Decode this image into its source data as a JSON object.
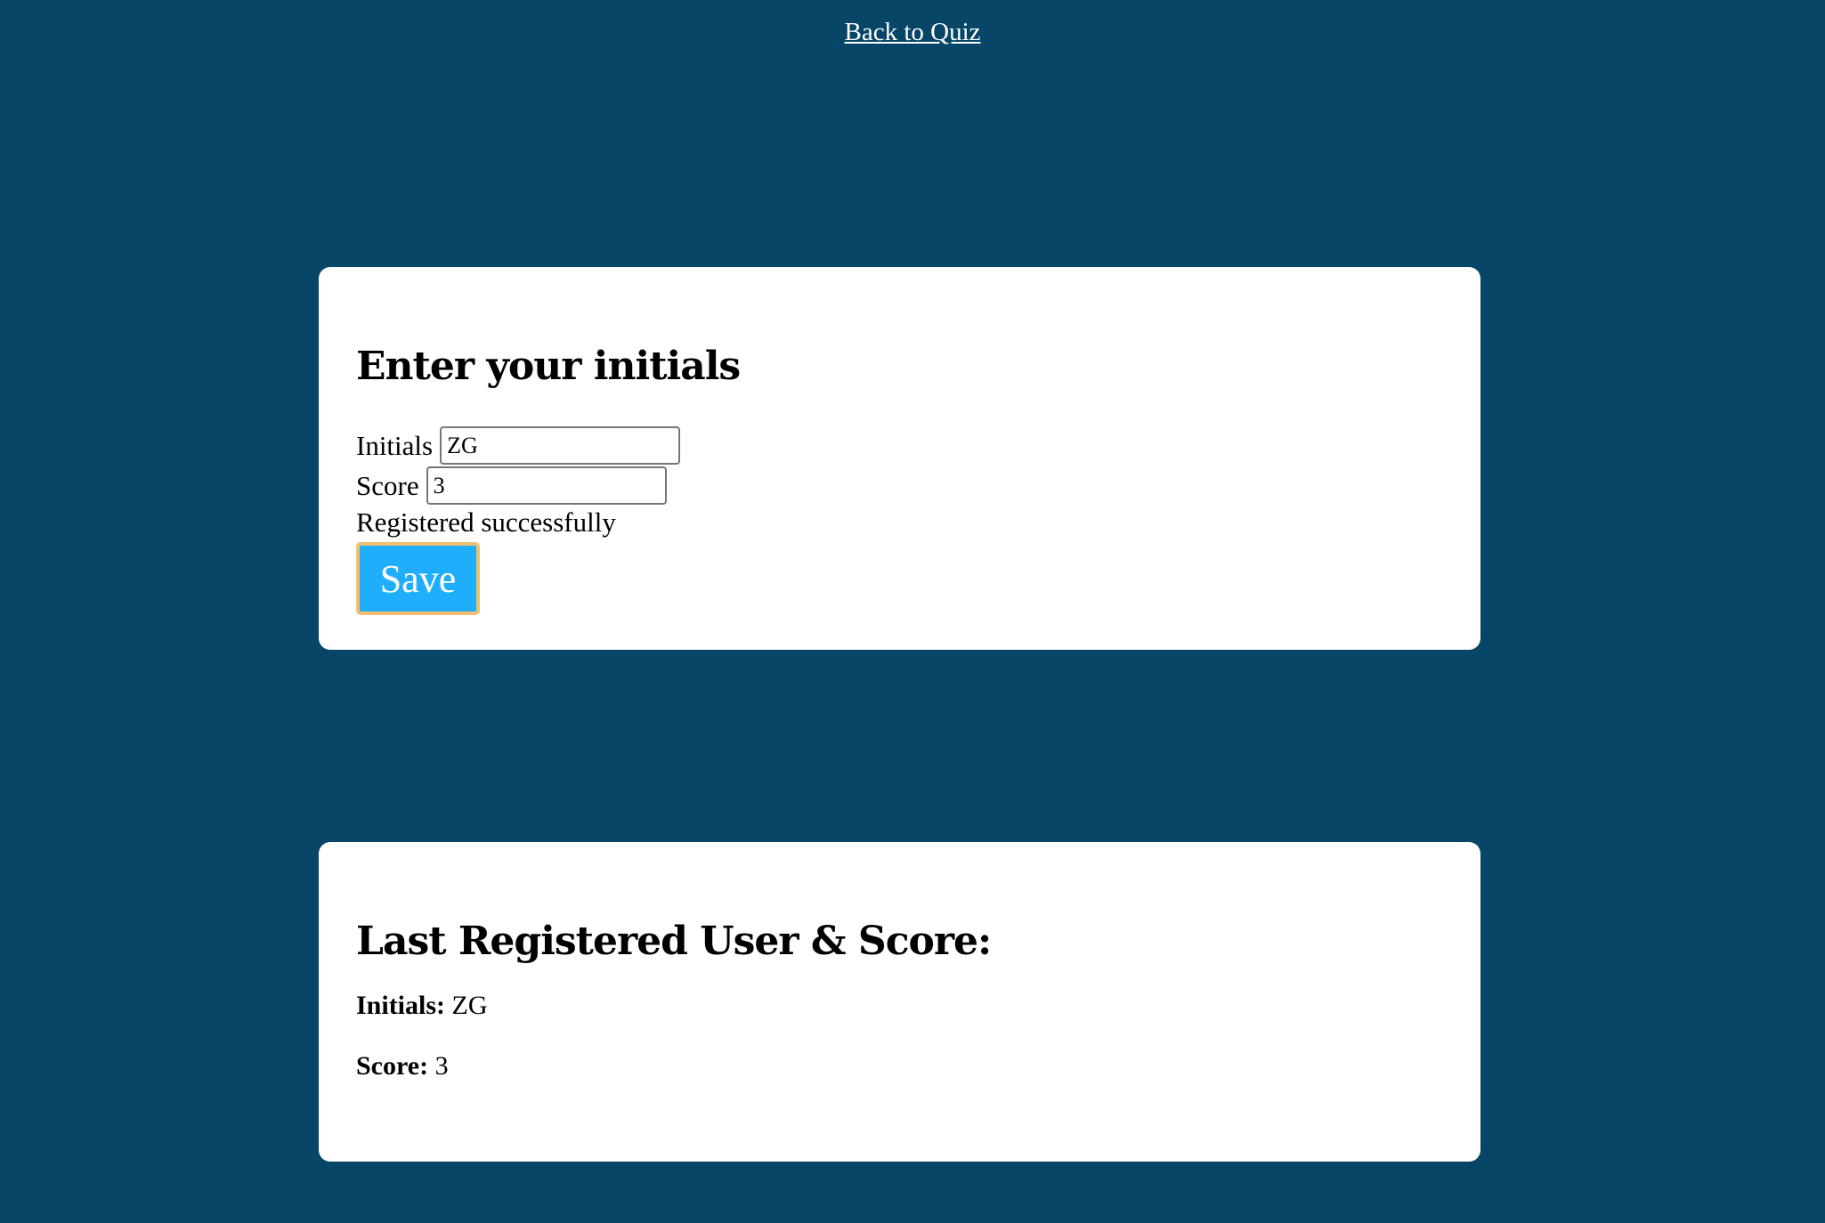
{
  "nav": {
    "back_link": "Back to Quiz"
  },
  "form_card": {
    "title": "Enter your initials",
    "initials_label": "Initials",
    "initials_value": "ZG",
    "score_label": "Score",
    "score_value": "3",
    "status": "Registered successfully",
    "save_label": "Save"
  },
  "last_card": {
    "title": "Last Registered User & Score:",
    "initials_label": "Initials:",
    "initials_value": "ZG",
    "score_label": "Score:",
    "score_value": "3"
  },
  "colors": {
    "background": "#074667",
    "button": "#1eaefc",
    "button_border": "#f0c070"
  }
}
